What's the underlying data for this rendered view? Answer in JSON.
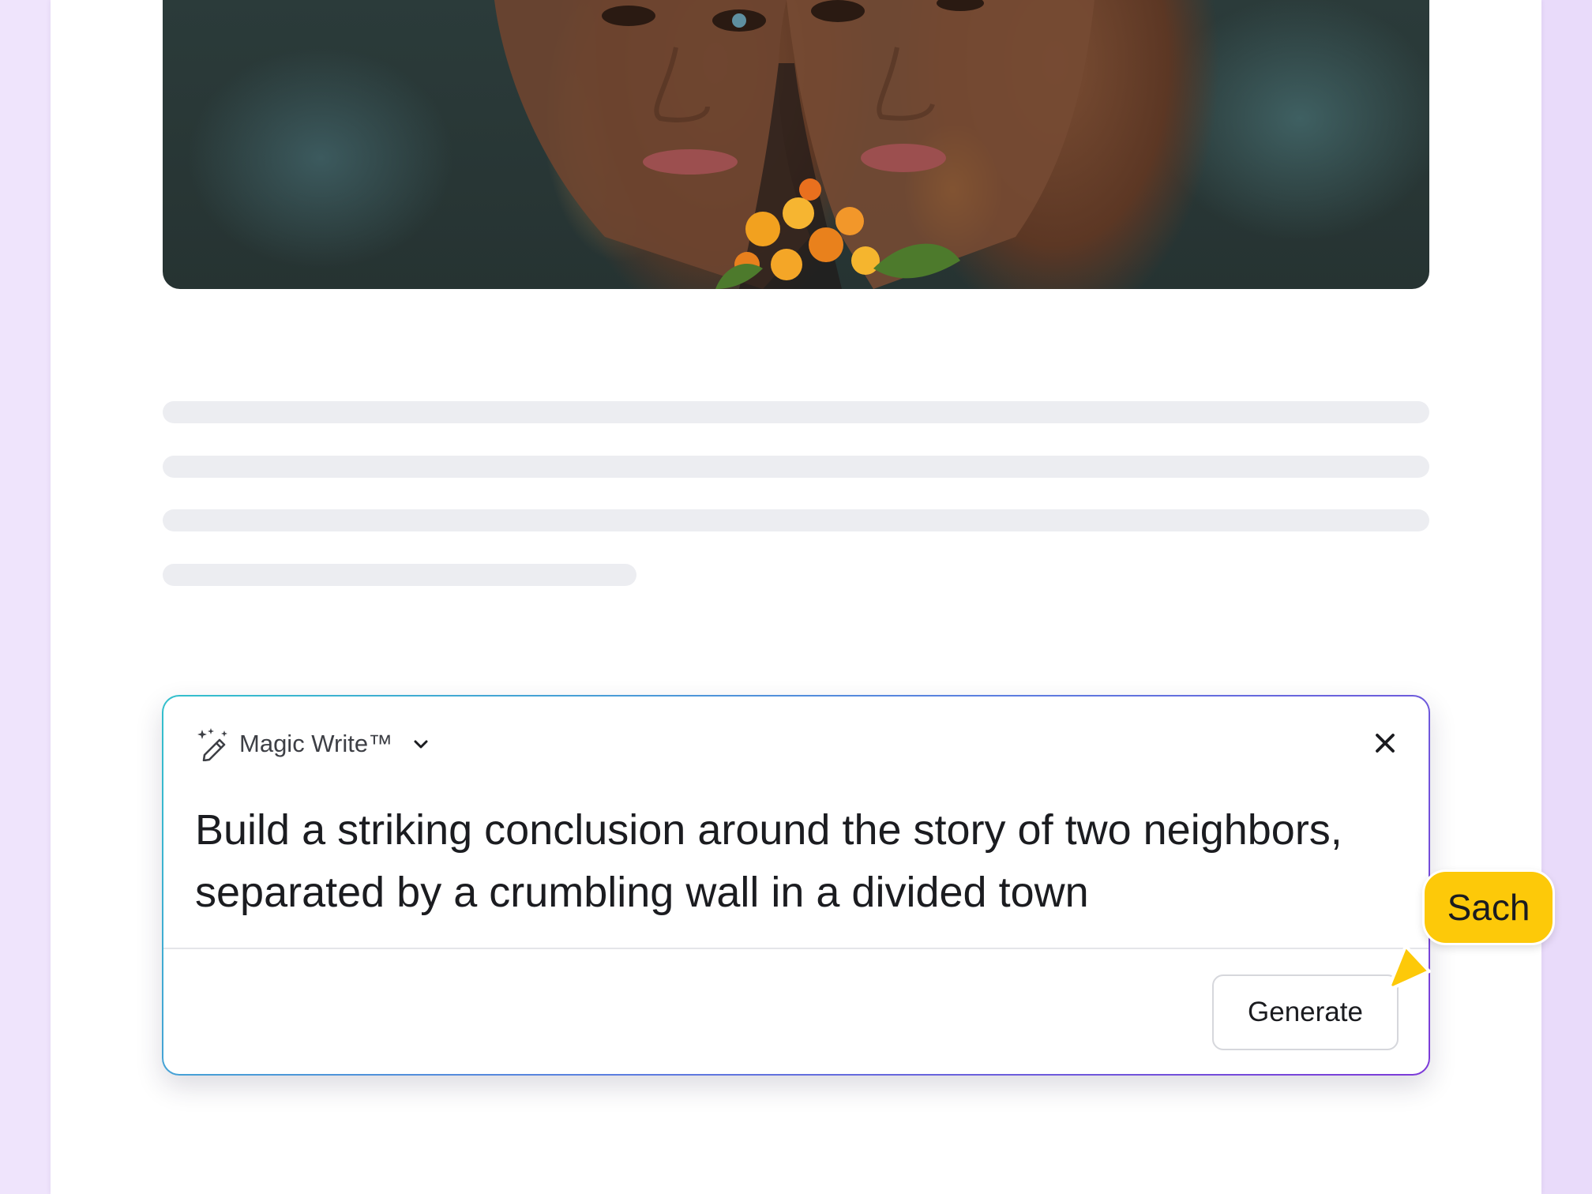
{
  "magic_write": {
    "title": "Magic Write™",
    "prompt": "Build a striking conclusion around the story of two neighbors, separated by a crumbling wall in a divided town",
    "generate_label": "Generate"
  },
  "collaborator_cursor": {
    "name": "Sach",
    "color": "#fdc909"
  },
  "icons": {
    "magic_write": "magic-wand-icon",
    "dropdown": "chevron-down-icon",
    "close": "close-icon"
  },
  "colors": {
    "card_gradient": [
      "#33c0cc",
      "#5b7fe0",
      "#7d3ad8"
    ],
    "background": "#efe4fc",
    "skeleton": "#ecedf1"
  }
}
